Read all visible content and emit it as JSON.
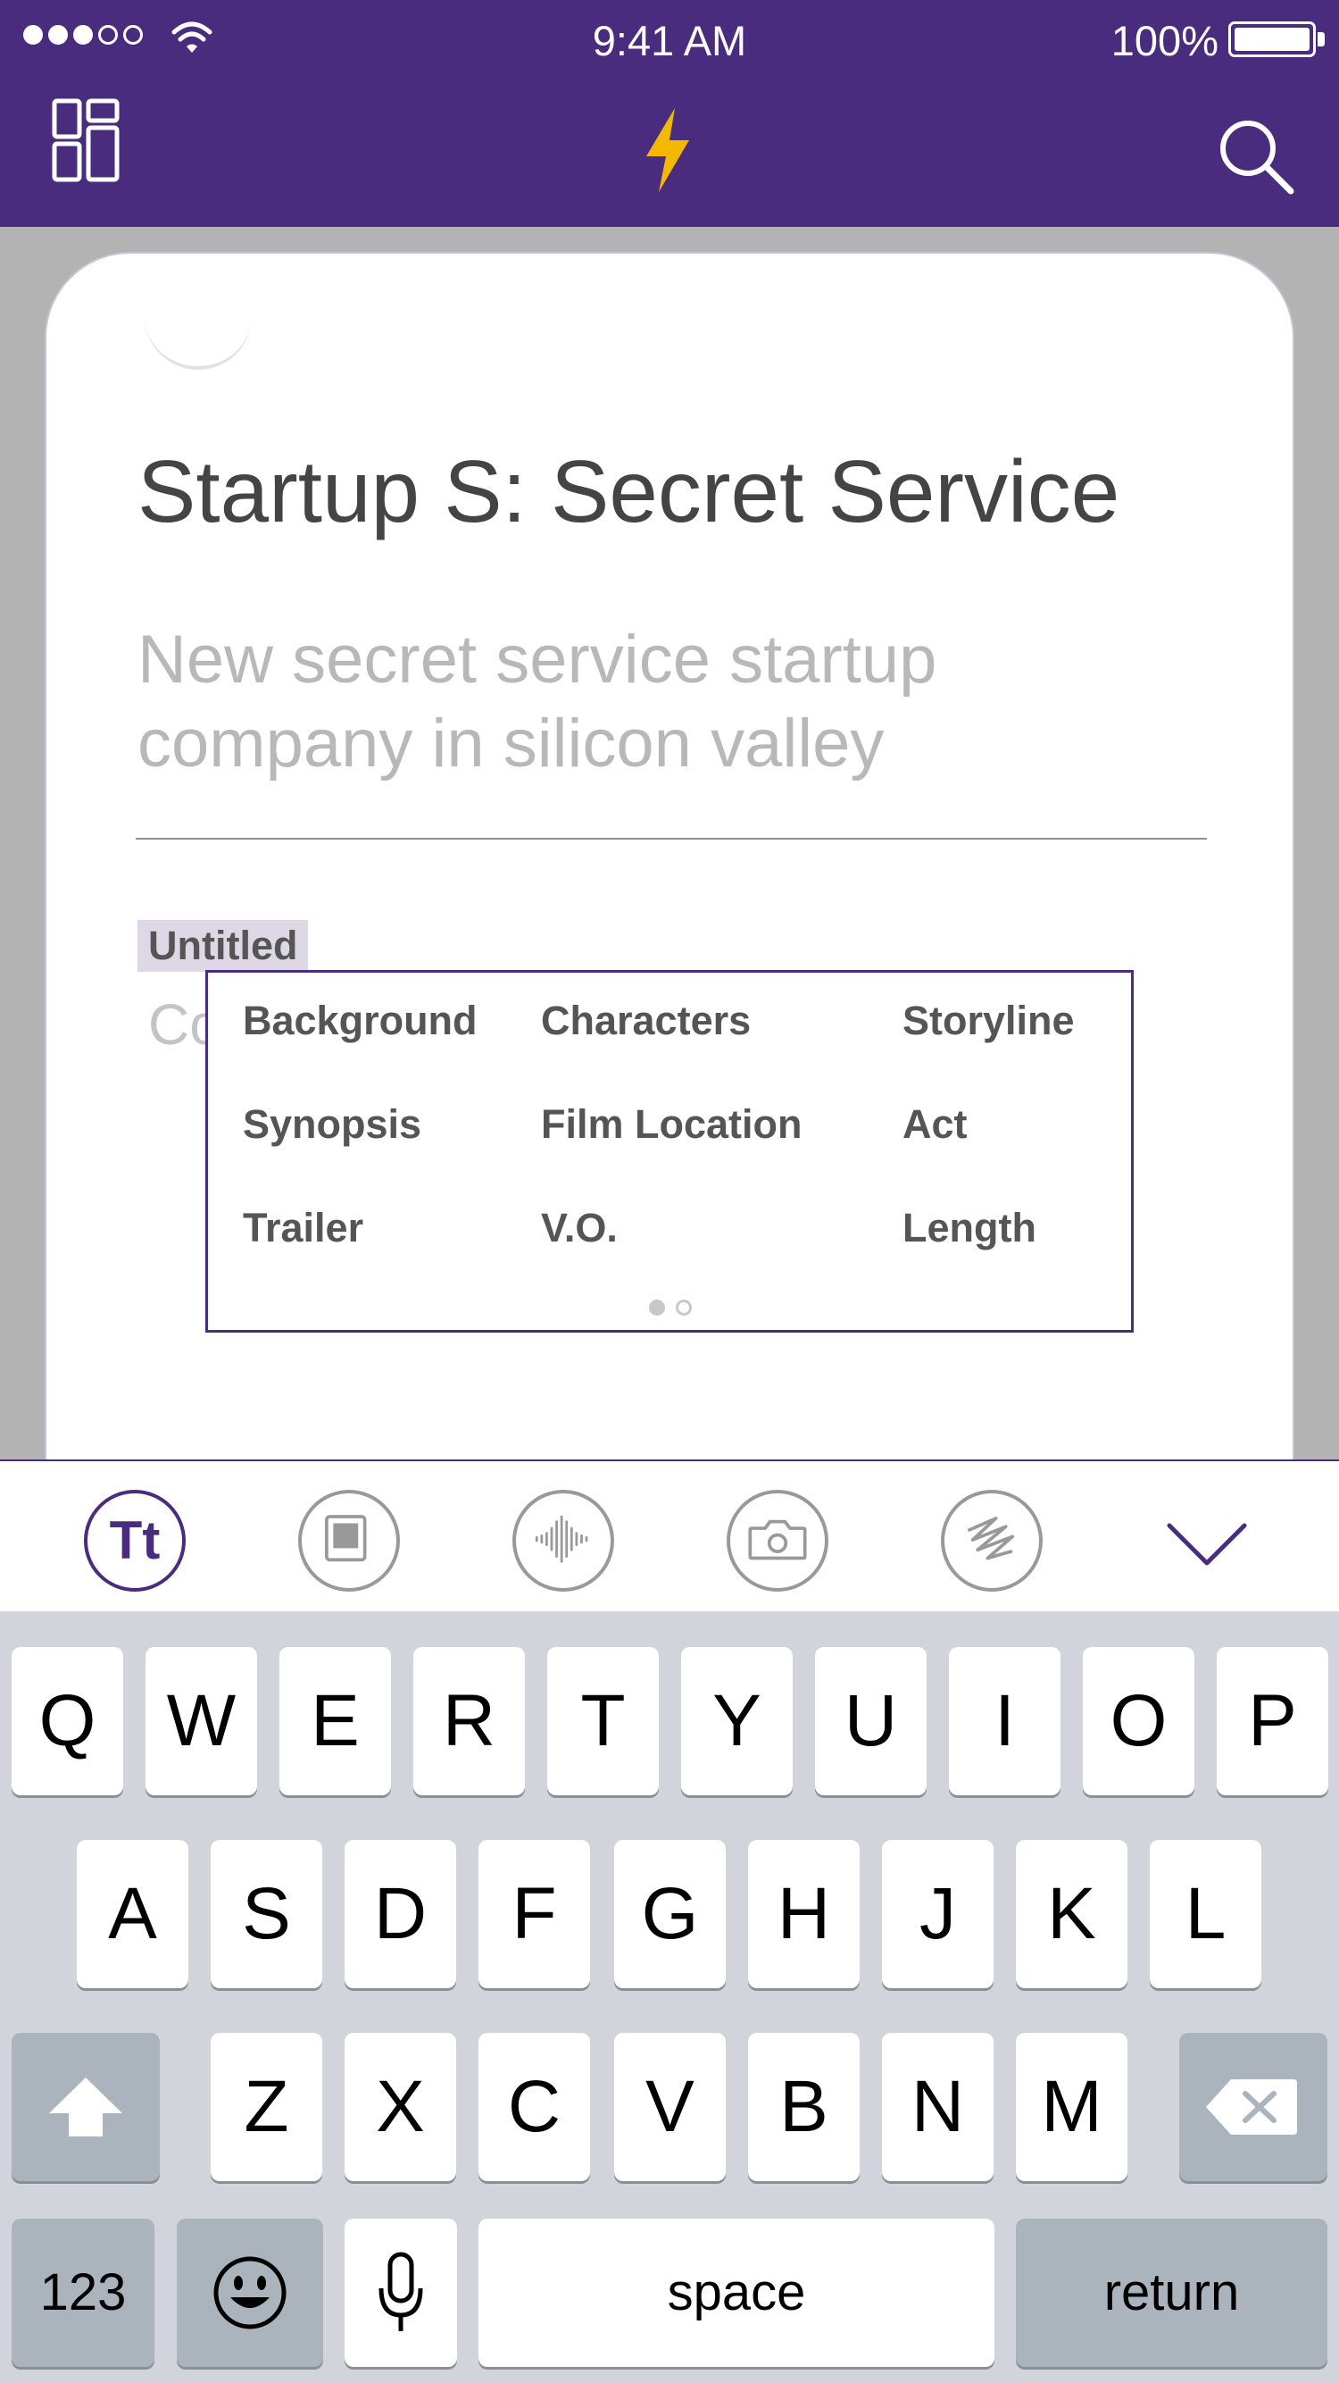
{
  "status_bar": {
    "time": "9:41 AM",
    "battery": "100%",
    "signal_icon": "signal-dots-icon",
    "wifi_icon": "wifi-icon",
    "battery_icon": "battery-icon"
  },
  "nav_bar": {
    "left_icon": "layout-grid-icon",
    "center_icon": "lightning-bolt-icon",
    "right_icon": "search-icon",
    "bolt_color": "#f5b800"
  },
  "document": {
    "title": "Startup S: Secret Service",
    "subtitle": "New secret service startup company in silicon valley",
    "section_tag": "Untitled",
    "placeholder_prefix": "Co"
  },
  "element_picker": {
    "items": [
      "Background",
      "Characters",
      "Storyline",
      "Synopsis",
      "Film Location",
      "Act",
      "Trailer",
      "V.O.",
      "Length"
    ],
    "page_count": 2,
    "current_page": 1
  },
  "toolbar": {
    "tools": [
      "text-format-icon",
      "media-frame-icon",
      "audio-waveform-icon",
      "camera-icon",
      "scribble-icon"
    ],
    "text_tool_label": "Tt",
    "collapse_icon": "chevron-down-icon"
  },
  "keyboard": {
    "row1": [
      "Q",
      "W",
      "E",
      "R",
      "T",
      "Y",
      "U",
      "I",
      "O",
      "P"
    ],
    "row2": [
      "A",
      "S",
      "D",
      "F",
      "G",
      "H",
      "J",
      "K",
      "L"
    ],
    "row3": [
      "Z",
      "X",
      "C",
      "V",
      "B",
      "N",
      "M"
    ],
    "numbers_label": "123",
    "space_label": "space",
    "return_label": "return"
  },
  "colors": {
    "brand_purple": "#4a2c7f",
    "backdrop_gray": "#b3b3b3",
    "keyboard_bg": "#d1d5db"
  }
}
